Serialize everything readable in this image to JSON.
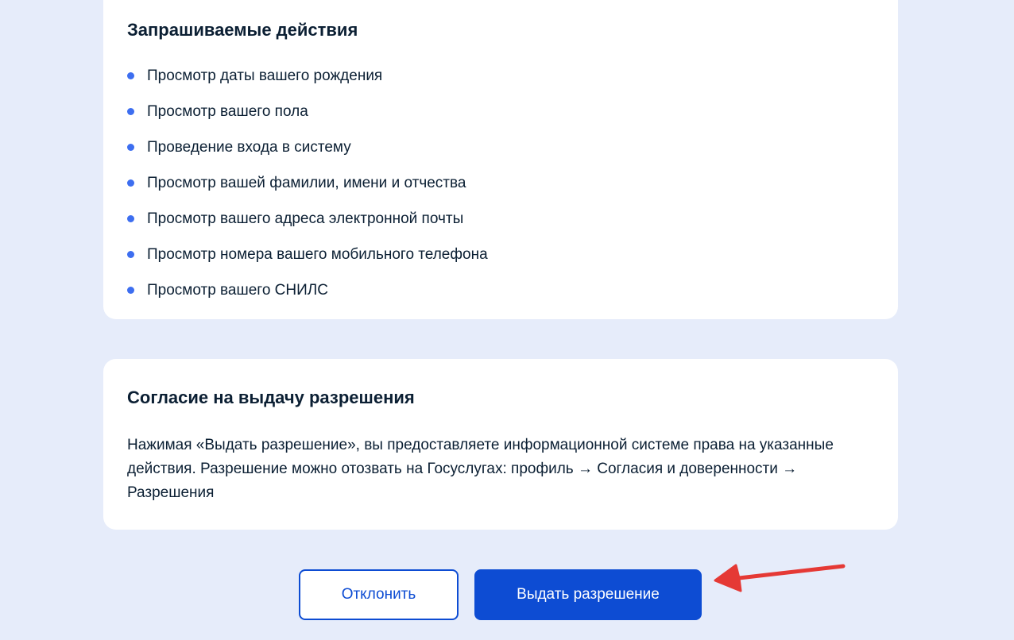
{
  "actions_card": {
    "title": "Запрашиваемые действия",
    "items": [
      "Просмотр даты вашего рождения",
      "Просмотр вашего пола",
      "Проведение входа в систему",
      "Просмотр вашей фамилии, имени и отчества",
      "Просмотр вашего адреса электронной почты",
      "Просмотр номера вашего мобильного телефона",
      "Просмотр вашего СНИЛС"
    ]
  },
  "consent_card": {
    "title": "Согласие на выдачу разрешения",
    "text": "Нажимая «Выдать разрешение», вы предоставляете информационной системе права на указанные действия. Разрешение можно отозвать на Госуслугах: профиль → Согласия и доверенности → Разрешения"
  },
  "buttons": {
    "decline_label": "Отклонить",
    "grant_label": "Выдать разрешение"
  },
  "colors": {
    "accent": "#0d4cd3",
    "bullet": "#3d6ef0",
    "background": "#e6ecfa",
    "annotation_arrow": "#e53935"
  },
  "annotation": {
    "icon": "red-arrow-icon"
  }
}
